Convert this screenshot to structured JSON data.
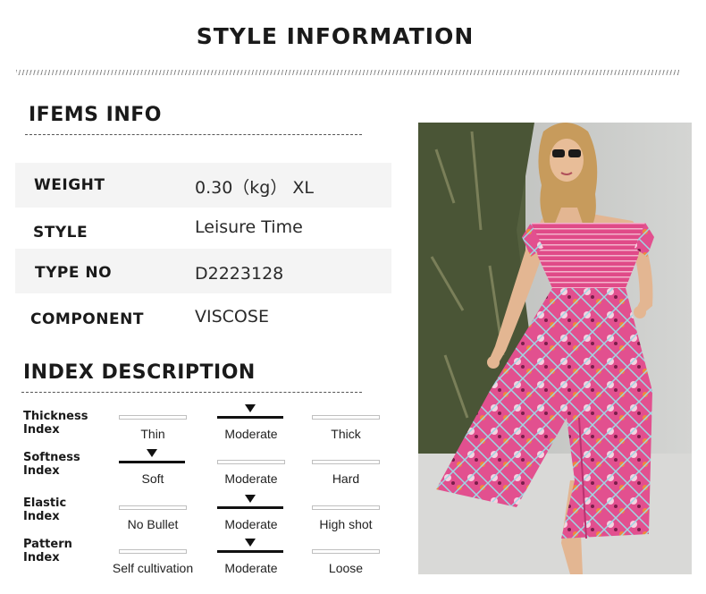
{
  "header": {
    "title": "STYLE INFORMATION"
  },
  "items_info": {
    "title": "IFEMS INFO",
    "rows": [
      {
        "label": "WEIGHT",
        "value": "0.30（kg） XL"
      },
      {
        "label": "STYLE",
        "value": "Leisure Time"
      },
      {
        "label": "TYPE NO",
        "value": "D2223128"
      },
      {
        "label": "COMPONENT",
        "value": "VISCOSE"
      }
    ]
  },
  "index_description": {
    "title": "INDEX DESCRIPTION",
    "indices": [
      {
        "label_line1": "Thickness",
        "label_line2": "Index",
        "options": [
          "Thin",
          "Moderate",
          "Thick"
        ],
        "selected": "Moderate"
      },
      {
        "label_line1": "Softness",
        "label_line2": "Index",
        "options": [
          "Soft",
          "Moderate",
          "Hard"
        ],
        "selected": "Soft"
      },
      {
        "label_line1": "Elastic",
        "label_line2": "Index",
        "options": [
          "No Bullet",
          "Moderate",
          "High shot"
        ],
        "selected": "Moderate"
      },
      {
        "label_line1": "Pattern",
        "label_line2": "Index",
        "options": [
          "Self cultivation",
          "Moderate",
          "Loose"
        ],
        "selected": "Moderate"
      }
    ]
  },
  "product_photo": {
    "subject": "woman-in-pink-floral-off-shoulder-midi-dress",
    "colors": {
      "dress": "#e2508f",
      "background_wall": "#c9cac8",
      "foliage": "#55603f"
    }
  }
}
